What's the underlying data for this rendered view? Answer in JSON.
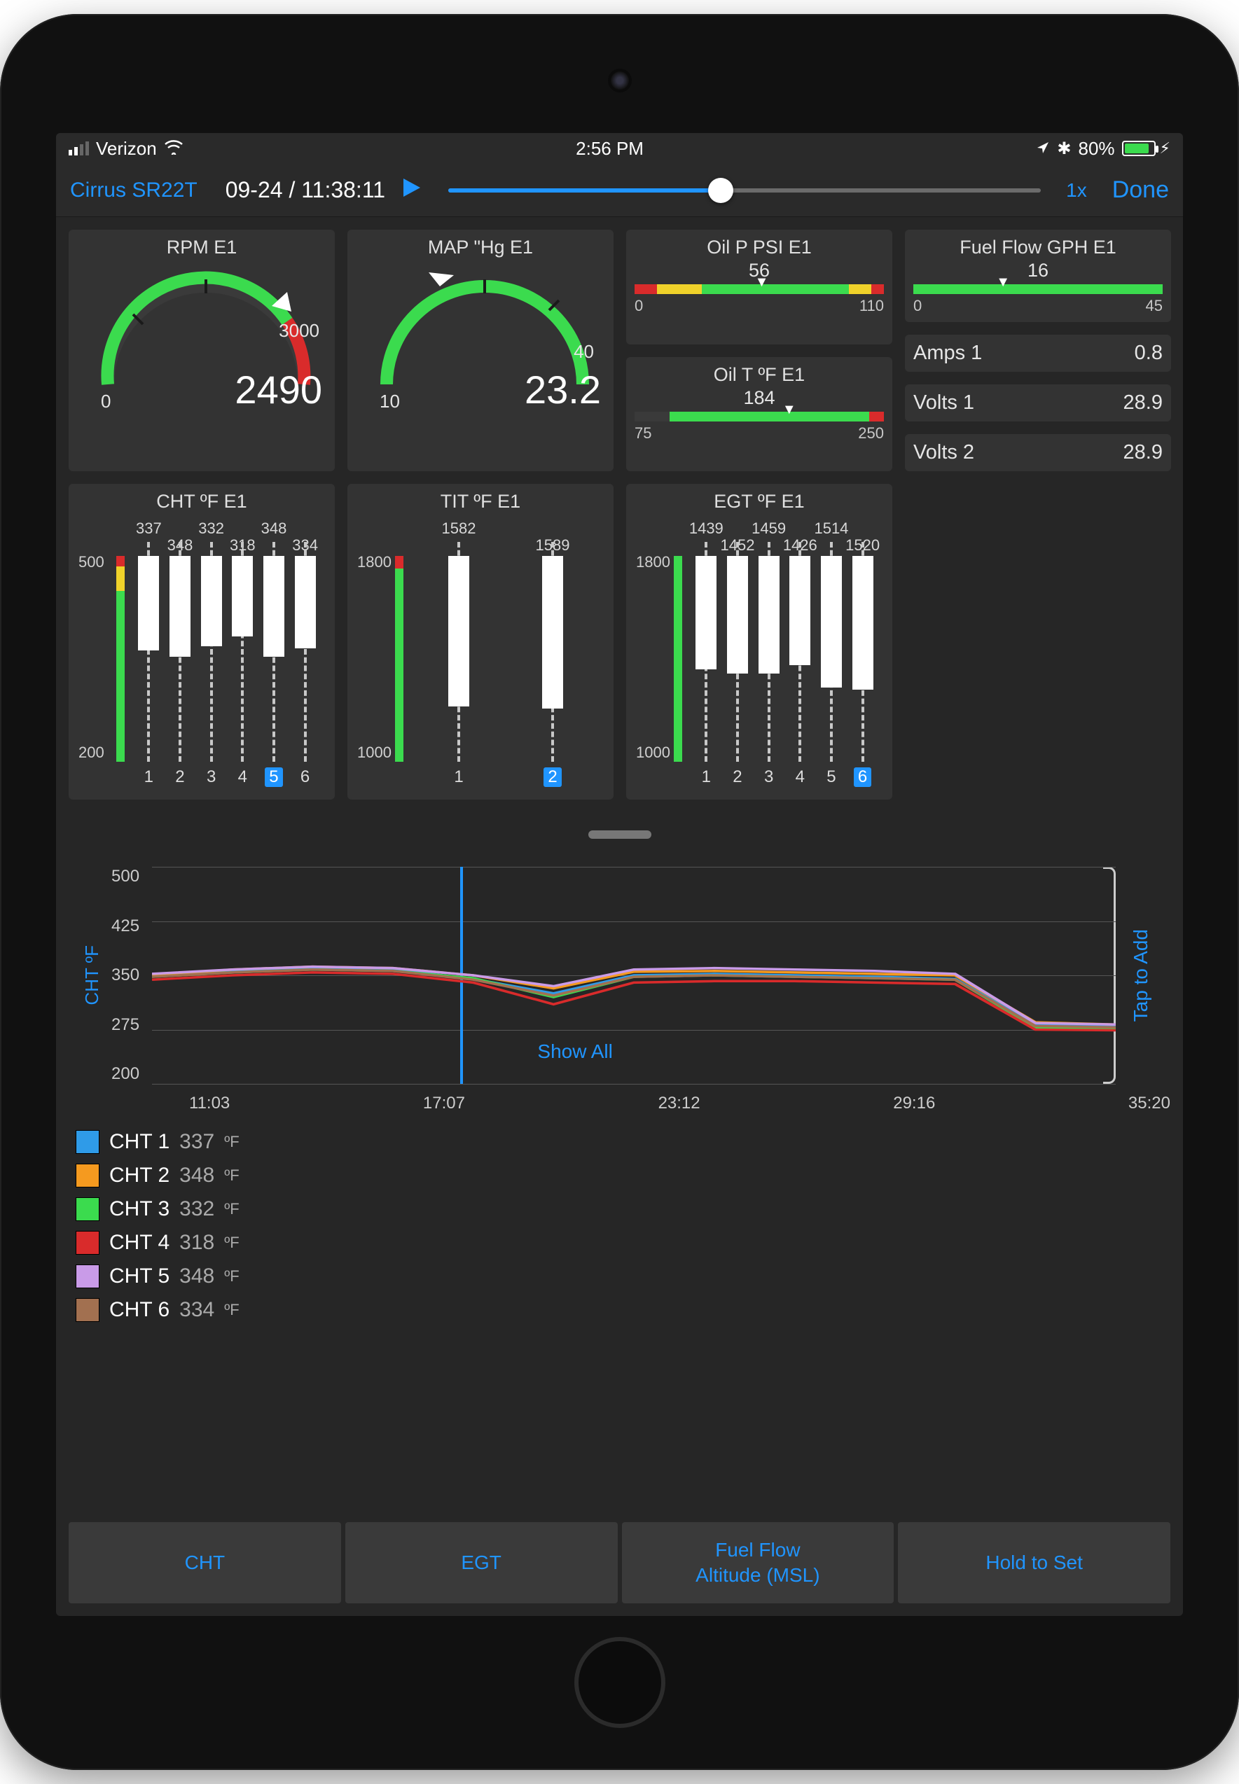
{
  "status": {
    "carrier": "Verizon",
    "time": "2:56 PM",
    "battery_pct": "80%"
  },
  "nav": {
    "title": "Cirrus SR22T",
    "timestamp": "09-24 / 11:38:11",
    "speed": "1x",
    "done": "Done",
    "slider_pct": 46
  },
  "gauges": {
    "rpm": {
      "title": "RPM E1",
      "min": "0",
      "max": "3000",
      "value": "2490",
      "pct_of_max": 0.83
    },
    "map": {
      "title": "MAP \"Hg E1",
      "min": "10",
      "max": "40",
      "value": "23.2",
      "pct_of_max": 0.44
    },
    "oilp": {
      "title": "Oil P PSI E1",
      "value": "56",
      "min": "0",
      "max": "110",
      "ptr_pct": 51,
      "segments": [
        {
          "color": "#d92b2b",
          "start": 0,
          "end": 9
        },
        {
          "color": "#f0d22a",
          "start": 9,
          "end": 27
        },
        {
          "color": "#3bdb4e",
          "start": 27,
          "end": 86
        },
        {
          "color": "#f0d22a",
          "start": 86,
          "end": 95
        },
        {
          "color": "#d92b2b",
          "start": 95,
          "end": 100
        }
      ]
    },
    "oilt": {
      "title": "Oil T ºF E1",
      "value": "184",
      "min": "75",
      "max": "250",
      "ptr_pct": 62,
      "segments": [
        {
          "color": "#3a3a3a",
          "start": 0,
          "end": 14
        },
        {
          "color": "#3bdb4e",
          "start": 14,
          "end": 94
        },
        {
          "color": "#d92b2b",
          "start": 94,
          "end": 100
        }
      ]
    },
    "fuel": {
      "title": "Fuel Flow GPH E1",
      "value": "16",
      "min": "0",
      "max": "45",
      "ptr_pct": 36,
      "segments": [
        {
          "color": "#3bdb4e",
          "start": 0,
          "end": 100
        }
      ]
    }
  },
  "kv": {
    "amps": {
      "label": "Amps 1",
      "value": "0.8"
    },
    "volts1": {
      "label": "Volts 1",
      "value": "28.9"
    },
    "volts2": {
      "label": "Volts 2",
      "value": "28.9"
    }
  },
  "bar_charts": {
    "cht": {
      "title": "CHT ºF E1",
      "ymin": "200",
      "ymax": "500",
      "highlight": 5,
      "scale_segments": [
        {
          "color": "#d92b2b",
          "top": 0,
          "h": 5
        },
        {
          "color": "#f0d22a",
          "top": 5,
          "h": 12
        },
        {
          "color": "#3bdb4e",
          "top": 17,
          "h": 83
        }
      ],
      "bars": [
        {
          "n": "1",
          "v": "337",
          "fill_pct": 46
        },
        {
          "n": "2",
          "v": "348",
          "fill_pct": 49
        },
        {
          "n": "3",
          "v": "332",
          "fill_pct": 44
        },
        {
          "n": "4",
          "v": "318",
          "fill_pct": 39
        },
        {
          "n": "5",
          "v": "348",
          "fill_pct": 49
        },
        {
          "n": "6",
          "v": "334",
          "fill_pct": 45
        }
      ]
    },
    "tit": {
      "title": "TIT ºF E1",
      "ymin": "1000",
      "ymax": "1800",
      "highlight": 2,
      "scale_segments": [
        {
          "color": "#d92b2b",
          "top": 0,
          "h": 6
        },
        {
          "color": "#3bdb4e",
          "top": 6,
          "h": 94
        }
      ],
      "bars": [
        {
          "n": "1",
          "v": "1582",
          "fill_pct": 73
        },
        {
          "n": "2",
          "v": "1589",
          "fill_pct": 74
        }
      ]
    },
    "egt": {
      "title": "EGT ºF E1",
      "ymin": "1000",
      "ymax": "1800",
      "highlight": 6,
      "scale_segments": [
        {
          "color": "#3bdb4e",
          "top": 0,
          "h": 100
        }
      ],
      "bars": [
        {
          "n": "1",
          "v": "1439",
          "fill_pct": 55
        },
        {
          "n": "2",
          "v": "1452",
          "fill_pct": 57
        },
        {
          "n": "3",
          "v": "1459",
          "fill_pct": 57
        },
        {
          "n": "4",
          "v": "1426",
          "fill_pct": 53
        },
        {
          "n": "5",
          "v": "1514",
          "fill_pct": 64
        },
        {
          "n": "6",
          "v": "1520",
          "fill_pct": 65
        }
      ]
    }
  },
  "chart_data": {
    "type": "line",
    "title": "",
    "ylabel": "CHT ºF",
    "xlabel": "",
    "ylim": [
      200,
      500
    ],
    "yticks": [
      200,
      275,
      350,
      425,
      500
    ],
    "xticks": [
      "11:03",
      "17:07",
      "23:12",
      "29:16",
      "35:20"
    ],
    "cursor_x_pct": 32,
    "show_all_label": "Show All",
    "tap_to_add_label": "Tap to Add",
    "series": [
      {
        "name": "CHT 1",
        "color": "#2f9be8",
        "values": [
          350,
          355,
          360,
          358,
          345,
          325,
          350,
          352,
          350,
          348,
          345,
          282,
          280
        ]
      },
      {
        "name": "CHT 2",
        "color": "#f59a1f",
        "values": [
          350,
          358,
          362,
          360,
          350,
          332,
          355,
          356,
          354,
          352,
          350,
          285,
          282
        ]
      },
      {
        "name": "CHT 3",
        "color": "#3bdb4e",
        "values": [
          348,
          354,
          358,
          356,
          346,
          320,
          348,
          350,
          348,
          346,
          344,
          278,
          276
        ]
      },
      {
        "name": "CHT 4",
        "color": "#d92b2b",
        "values": [
          344,
          350,
          354,
          352,
          340,
          310,
          340,
          342,
          342,
          340,
          338,
          275,
          274
        ]
      },
      {
        "name": "CHT 5",
        "color": "#c99be8",
        "values": [
          352,
          358,
          362,
          360,
          350,
          335,
          358,
          360,
          358,
          356,
          352,
          284,
          282
        ]
      },
      {
        "name": "CHT 6",
        "color": "#a27050",
        "values": [
          348,
          354,
          358,
          356,
          344,
          322,
          348,
          350,
          348,
          346,
          344,
          280,
          278
        ]
      }
    ]
  },
  "legend": [
    {
      "name": "CHT 1",
      "value": "337",
      "unit": "ºF",
      "color": "#2f9be8"
    },
    {
      "name": "CHT 2",
      "value": "348",
      "unit": "ºF",
      "color": "#f59a1f"
    },
    {
      "name": "CHT 3",
      "value": "332",
      "unit": "ºF",
      "color": "#3bdb4e"
    },
    {
      "name": "CHT 4",
      "value": "318",
      "unit": "ºF",
      "color": "#d92b2b"
    },
    {
      "name": "CHT 5",
      "value": "348",
      "unit": "ºF",
      "color": "#c99be8"
    },
    {
      "name": "CHT 6",
      "value": "334",
      "unit": "ºF",
      "color": "#a27050"
    }
  ],
  "tabs": {
    "cht": "CHT",
    "egt": "EGT",
    "fuel": "Fuel Flow\nAltitude (MSL)",
    "hold": "Hold to Set"
  }
}
